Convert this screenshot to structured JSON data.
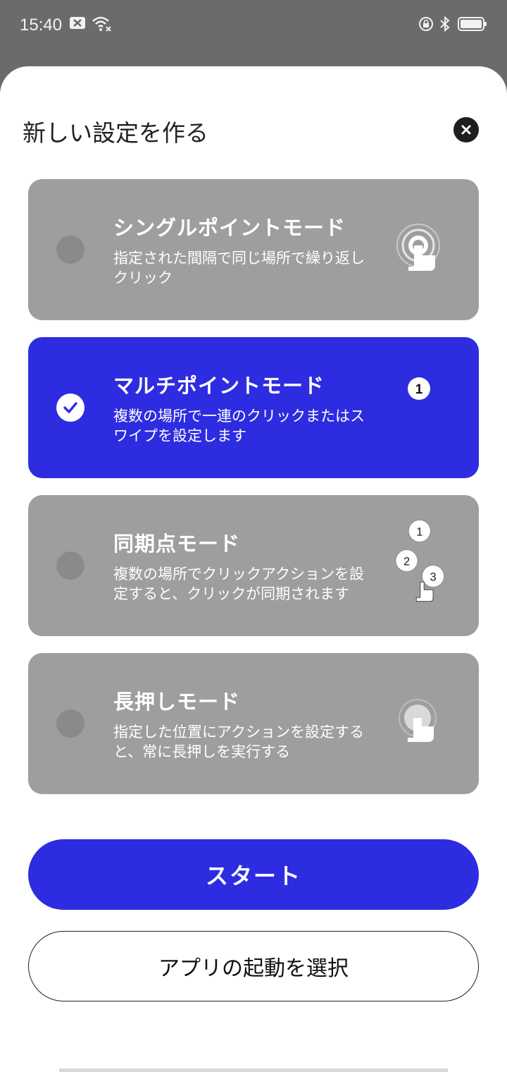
{
  "status_bar": {
    "time": "15:40"
  },
  "sheet": {
    "title": "新しい設定を作る",
    "modes": [
      {
        "title": "シングルポイントモード",
        "description": "指定された間隔で同じ場所で繰り返しクリック",
        "selected": false,
        "icon": "tap-ripple-icon"
      },
      {
        "title": "マルチポイントモード",
        "description": "複数の場所で一連のクリックまたはスワイプを設定します",
        "selected": true,
        "icon": "numbered-point-icon",
        "badge": "1"
      },
      {
        "title": "同期点モード",
        "description": "複数の場所でクリックアクションを設定すると、クリックが同期されます",
        "selected": false,
        "icon": "sync-points-icon",
        "points": [
          "1",
          "2",
          "3"
        ]
      },
      {
        "title": "長押しモード",
        "description": "指定した位置にアクションを設定すると、常に長押しを実行する",
        "selected": false,
        "icon": "long-press-icon"
      }
    ],
    "start_label": "スタート",
    "select_app_label": "アプリの起動を選択"
  },
  "colors": {
    "accent": "#2e2ce0",
    "card_inactive": "#9e9e9e",
    "scrim": "#6b6b6b"
  }
}
